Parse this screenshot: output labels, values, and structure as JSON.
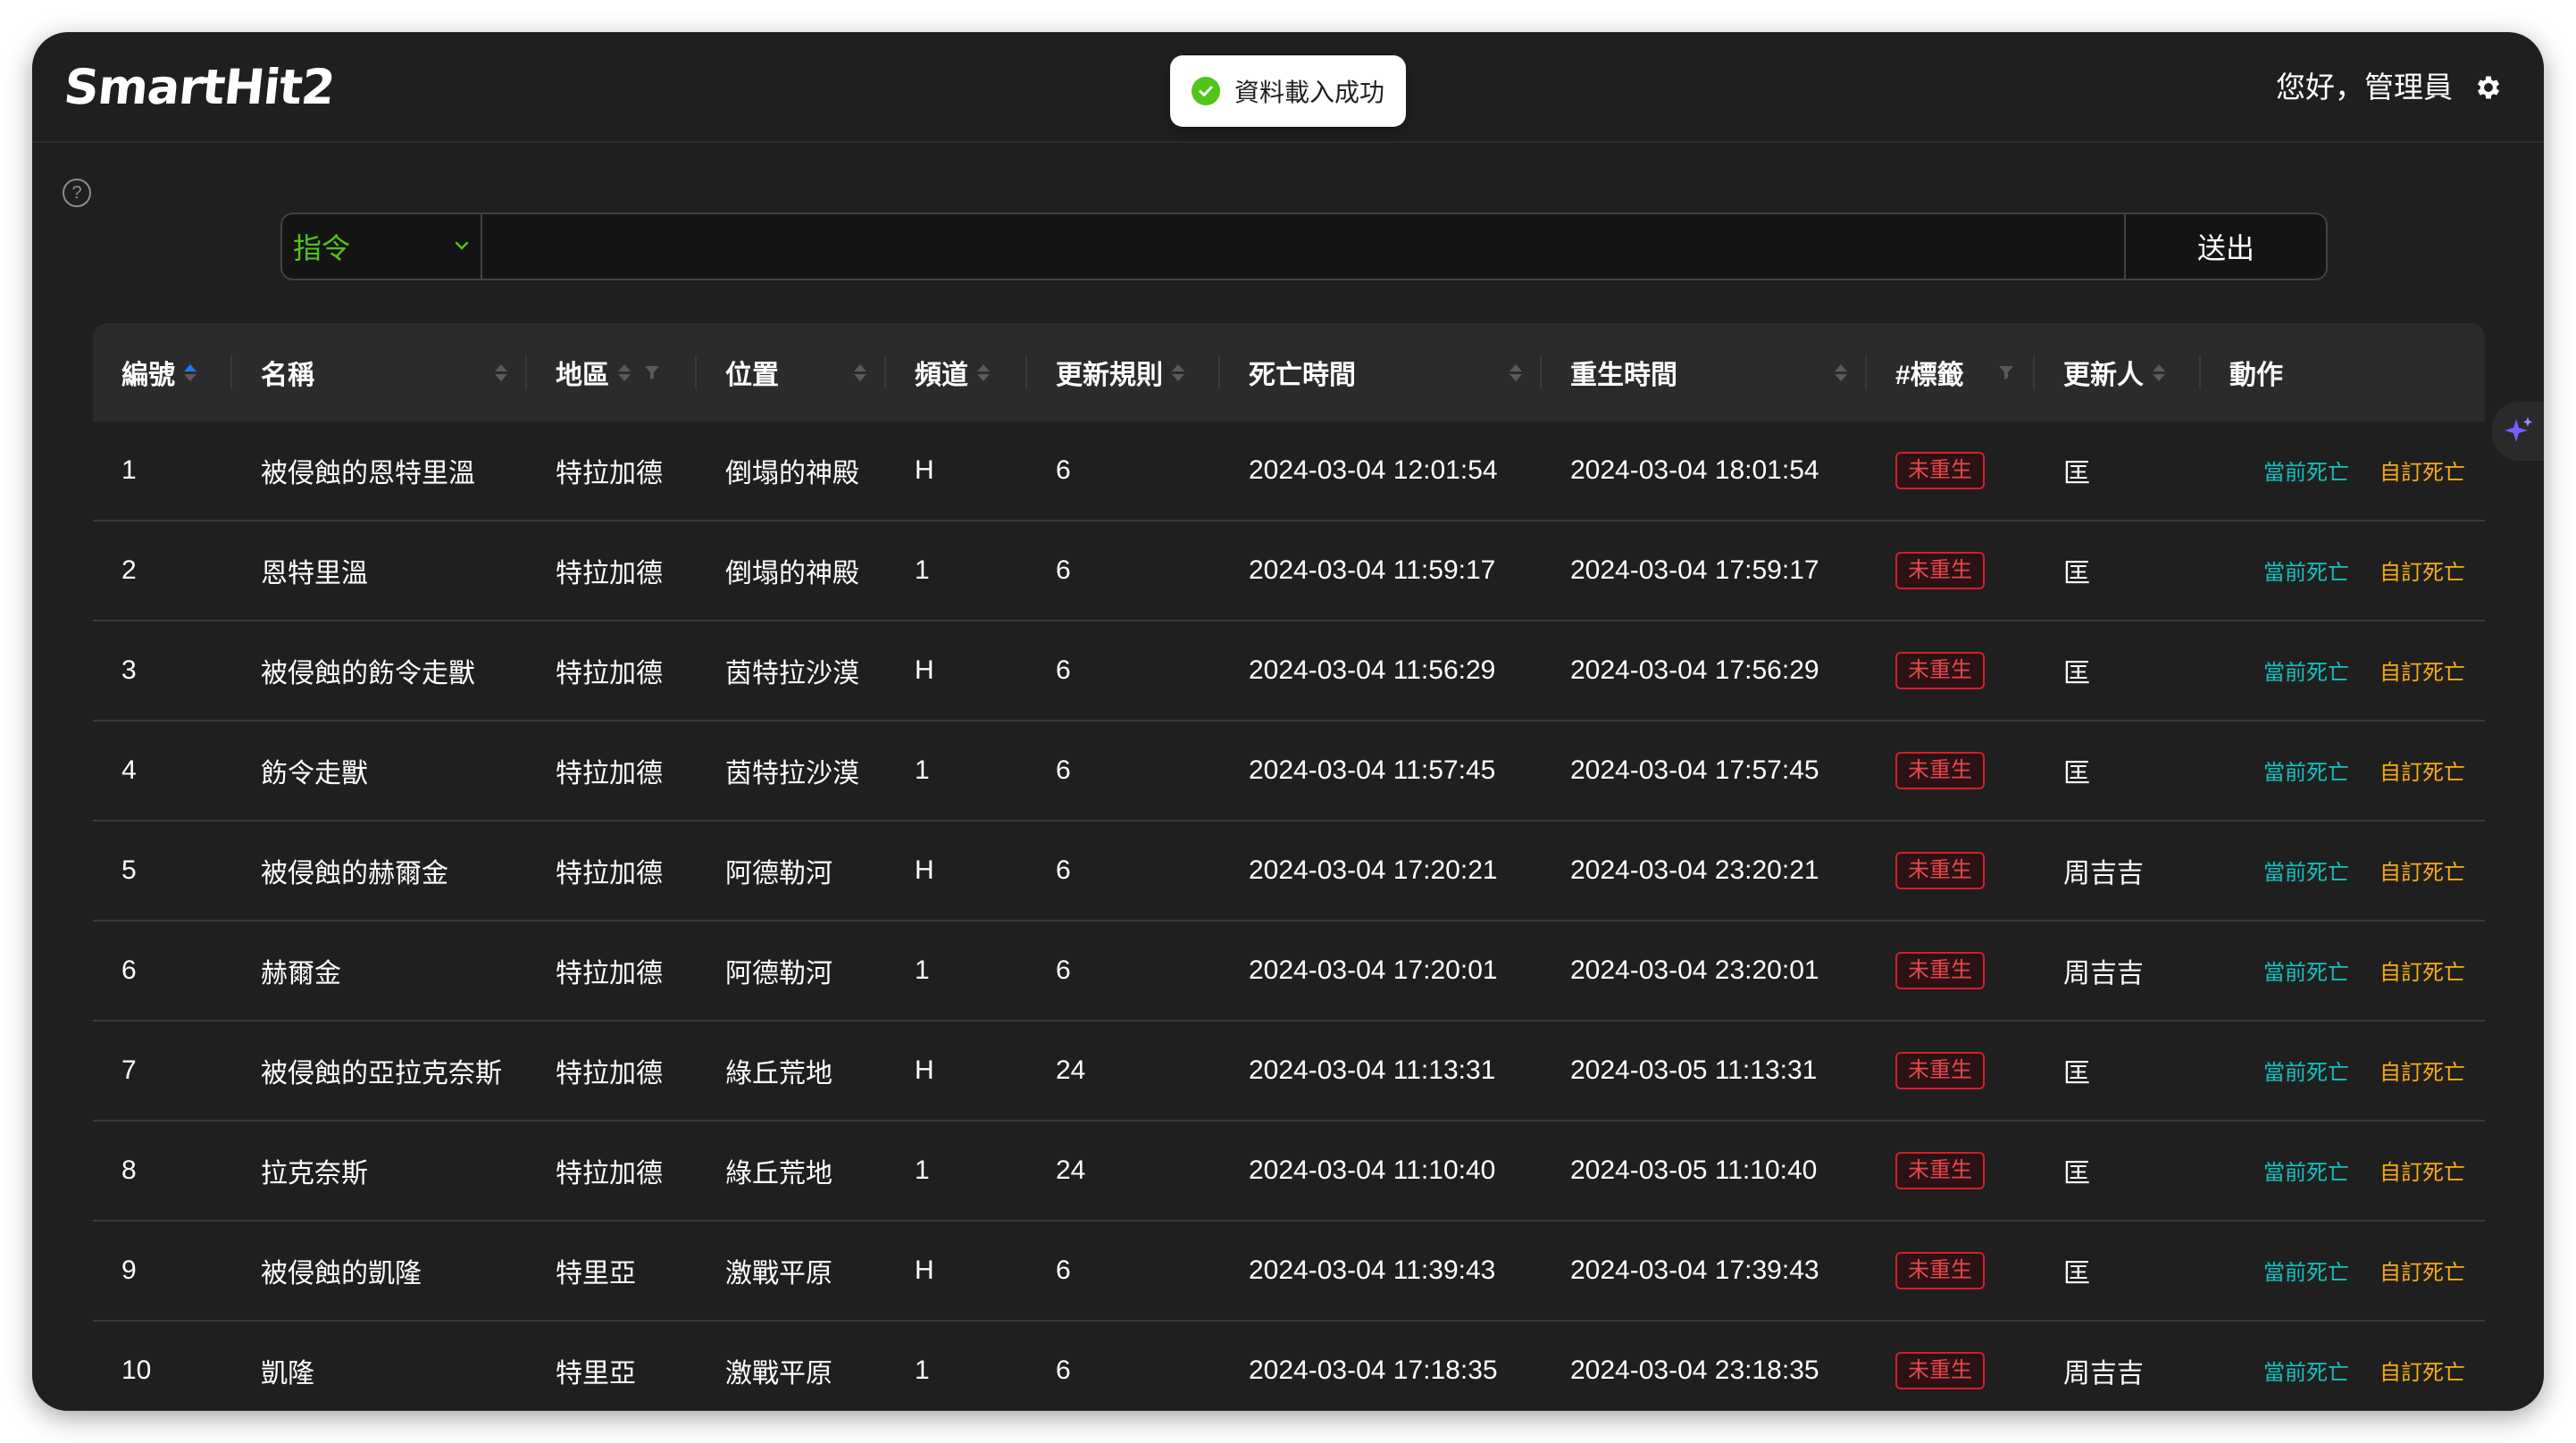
{
  "header": {
    "logo": "SmartHit2",
    "greeting": "您好，管理員",
    "settings_icon": "gear-icon"
  },
  "toast": {
    "message": "資料載入成功",
    "icon": "check-circle-icon",
    "color": "#52c41a"
  },
  "command_bar": {
    "select_value": "指令",
    "input_value": "",
    "send_label": "送出"
  },
  "table": {
    "columns": [
      "編號",
      "名稱",
      "地區",
      "位置",
      "頻道",
      "更新規則",
      "死亡時間",
      "重生時間",
      "#標籤",
      "更新人",
      "動作"
    ],
    "action_labels": {
      "current_death": "當前死亡",
      "custom_death": "自訂死亡"
    },
    "rows": [
      {
        "id": "1",
        "name": "被侵蝕的恩特里溫",
        "region": "特拉加德",
        "location": "倒塌的神殿",
        "channel": "H",
        "rule": "6",
        "death": "2024-03-04 12:01:54",
        "respawn": "2024-03-04 18:01:54",
        "tag": "未重生",
        "updater": "匡"
      },
      {
        "id": "2",
        "name": "恩特里溫",
        "region": "特拉加德",
        "location": "倒塌的神殿",
        "channel": "1",
        "rule": "6",
        "death": "2024-03-04 11:59:17",
        "respawn": "2024-03-04 17:59:17",
        "tag": "未重生",
        "updater": "匡"
      },
      {
        "id": "3",
        "name": "被侵蝕的飭令走獸",
        "region": "特拉加德",
        "location": "茵特拉沙漠",
        "channel": "H",
        "rule": "6",
        "death": "2024-03-04 11:56:29",
        "respawn": "2024-03-04 17:56:29",
        "tag": "未重生",
        "updater": "匡"
      },
      {
        "id": "4",
        "name": "飭令走獸",
        "region": "特拉加德",
        "location": "茵特拉沙漠",
        "channel": "1",
        "rule": "6",
        "death": "2024-03-04 11:57:45",
        "respawn": "2024-03-04 17:57:45",
        "tag": "未重生",
        "updater": "匡"
      },
      {
        "id": "5",
        "name": "被侵蝕的赫爾金",
        "region": "特拉加德",
        "location": "阿德勒河",
        "channel": "H",
        "rule": "6",
        "death": "2024-03-04 17:20:21",
        "respawn": "2024-03-04 23:20:21",
        "tag": "未重生",
        "updater": "周吉吉"
      },
      {
        "id": "6",
        "name": "赫爾金",
        "region": "特拉加德",
        "location": "阿德勒河",
        "channel": "1",
        "rule": "6",
        "death": "2024-03-04 17:20:01",
        "respawn": "2024-03-04 23:20:01",
        "tag": "未重生",
        "updater": "周吉吉"
      },
      {
        "id": "7",
        "name": "被侵蝕的亞拉克奈斯",
        "region": "特拉加德",
        "location": "綠丘荒地",
        "channel": "H",
        "rule": "24",
        "death": "2024-03-04 11:13:31",
        "respawn": "2024-03-05 11:13:31",
        "tag": "未重生",
        "updater": "匡"
      },
      {
        "id": "8",
        "name": "拉克奈斯",
        "region": "特拉加德",
        "location": "綠丘荒地",
        "channel": "1",
        "rule": "24",
        "death": "2024-03-04 11:10:40",
        "respawn": "2024-03-05 11:10:40",
        "tag": "未重生",
        "updater": "匡"
      },
      {
        "id": "9",
        "name": "被侵蝕的凱隆",
        "region": "特里亞",
        "location": "激戰平原",
        "channel": "H",
        "rule": "6",
        "death": "2024-03-04 11:39:43",
        "respawn": "2024-03-04 17:39:43",
        "tag": "未重生",
        "updater": "匡"
      },
      {
        "id": "10",
        "name": "凱隆",
        "region": "特里亞",
        "location": "激戰平原",
        "channel": "1",
        "rule": "6",
        "death": "2024-03-04 17:18:35",
        "respawn": "2024-03-04 23:18:35",
        "tag": "未重生",
        "updater": "周吉吉"
      }
    ]
  }
}
